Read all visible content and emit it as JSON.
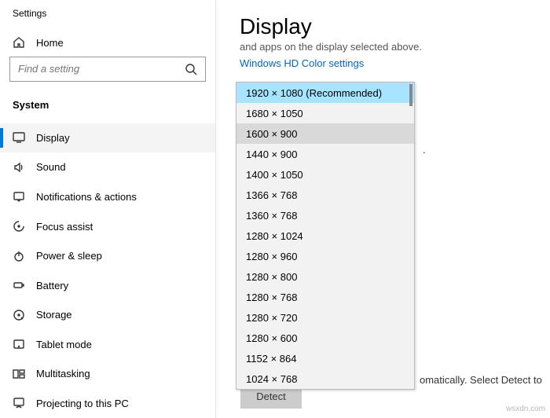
{
  "window_title": "Settings",
  "home_label": "Home",
  "search": {
    "placeholder": "Find a setting"
  },
  "group_header": "System",
  "nav": [
    {
      "icon": "display",
      "label": "Display",
      "selected": true
    },
    {
      "icon": "sound",
      "label": "Sound"
    },
    {
      "icon": "notifications",
      "label": "Notifications & actions"
    },
    {
      "icon": "focus",
      "label": "Focus assist"
    },
    {
      "icon": "power",
      "label": "Power & sleep"
    },
    {
      "icon": "battery",
      "label": "Battery"
    },
    {
      "icon": "storage",
      "label": "Storage"
    },
    {
      "icon": "tablet",
      "label": "Tablet mode"
    },
    {
      "icon": "multitask",
      "label": "Multitasking"
    },
    {
      "icon": "projecting",
      "label": "Projecting to this PC"
    }
  ],
  "main": {
    "title": "Display",
    "subtitle": "and apps on the display selected above.",
    "link": "Windows HD Color settings",
    "peek_right": ".",
    "detect_hint": "omatically. Select Detect to",
    "detect_button": "Detect"
  },
  "resolution_dropdown": {
    "highlighted": 0,
    "hovered": 2,
    "options": [
      "1920 × 1080 (Recommended)",
      "1680 × 1050",
      "1600 × 900",
      "1440 × 900",
      "1400 × 1050",
      "1366 × 768",
      "1360 × 768",
      "1280 × 1024",
      "1280 × 960",
      "1280 × 800",
      "1280 × 768",
      "1280 × 720",
      "1280 × 600",
      "1152 × 864",
      "1024 × 768"
    ]
  },
  "watermark": "wsxdn.com"
}
